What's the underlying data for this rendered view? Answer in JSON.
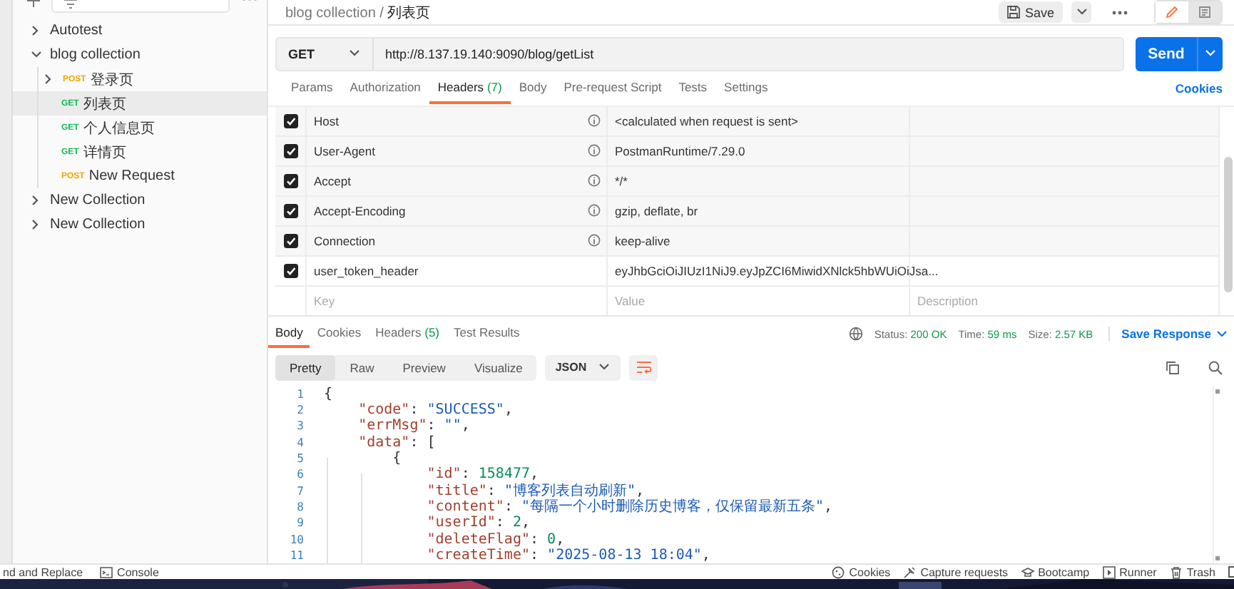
{
  "sidebar": {
    "tree": [
      {
        "kind": "collection",
        "label": "Autotest",
        "expanded": false,
        "selected": false
      },
      {
        "kind": "collection",
        "label": "blog collection",
        "expanded": true,
        "selected": false,
        "children": [
          {
            "kind": "folder",
            "method": "POST",
            "label": "登录页",
            "expanded": false,
            "selected": false
          },
          {
            "kind": "request",
            "method": "GET",
            "label": "列表页",
            "selected": true
          },
          {
            "kind": "request",
            "method": "GET",
            "label": "个人信息页",
            "selected": false
          },
          {
            "kind": "request",
            "method": "GET",
            "label": "详情页",
            "selected": false
          },
          {
            "kind": "request",
            "method": "POST",
            "label": "New Request",
            "selected": false
          }
        ]
      },
      {
        "kind": "collection",
        "label": "New Collection",
        "expanded": false,
        "selected": false
      },
      {
        "kind": "collection",
        "label": "New Collection",
        "expanded": false,
        "selected": false
      }
    ]
  },
  "breadcrumb": {
    "parent": "blog collection",
    "separator": "/",
    "current": "列表页"
  },
  "toolbar": {
    "save": "Save",
    "modes": [
      {
        "kind": "edit",
        "selected": true
      },
      {
        "kind": "docs",
        "selected": false
      }
    ]
  },
  "request": {
    "method": "GET",
    "url": "http://8.137.19.140:9090/blog/getList",
    "send": "Send"
  },
  "request_tabs": [
    {
      "label": "Params",
      "selected": false
    },
    {
      "label": "Authorization",
      "selected": false
    },
    {
      "label": "Headers",
      "count": "(7)",
      "selected": true
    },
    {
      "label": "Body",
      "selected": false
    },
    {
      "label": "Pre-request Script",
      "selected": false
    },
    {
      "label": "Tests",
      "selected": false
    },
    {
      "label": "Settings",
      "selected": false
    }
  ],
  "cookies_link": "Cookies",
  "headers": [
    {
      "checked": true,
      "key": "Host",
      "auto": true,
      "value": "<calculated when request is sent>"
    },
    {
      "checked": true,
      "key": "User-Agent",
      "auto": true,
      "value": "PostmanRuntime/7.29.0"
    },
    {
      "checked": true,
      "key": "Accept",
      "auto": true,
      "value": "*/*"
    },
    {
      "checked": true,
      "key": "Accept-Encoding",
      "auto": true,
      "value": "gzip, deflate, br"
    },
    {
      "checked": true,
      "key": "Connection",
      "auto": true,
      "value": "keep-alive"
    },
    {
      "checked": true,
      "key": "user_token_header",
      "auto": false,
      "value": "eyJhbGciOiJIUzI1NiJ9.eyJpZCI6MiwidXNlck5hbWUiOiJsa..."
    }
  ],
  "new_header": {
    "key": {
      "placeholder": "Key"
    },
    "value": {
      "placeholder": "Value"
    },
    "description": {
      "placeholder": "Description"
    }
  },
  "response": {
    "tabs": [
      {
        "label": "Body",
        "selected": true
      },
      {
        "label": "Cookies",
        "selected": false
      },
      {
        "label": "Headers",
        "count": "(5)",
        "selected": false
      },
      {
        "label": "Test Results",
        "selected": false
      }
    ],
    "status_label": "Status:",
    "status": "200 OK",
    "time_label": "Time:",
    "time": "59 ms",
    "size_label": "Size:",
    "size": "2.57 KB",
    "save_response": "Save Response",
    "views": [
      {
        "label": "Pretty",
        "selected": true
      },
      {
        "label": "Raw",
        "selected": false
      },
      {
        "label": "Preview",
        "selected": false
      },
      {
        "label": "Visualize",
        "selected": false
      }
    ],
    "format": "JSON",
    "code_lines": [
      {
        "number": "1",
        "tokens": [
          {
            "kind": "punct",
            "text": "{"
          }
        ]
      },
      {
        "number": "2",
        "tokens": [
          {
            "kind": "key",
            "text": "    \"code\""
          },
          {
            "kind": "punct",
            "text": ": "
          },
          {
            "kind": "string",
            "text": "\"SUCCESS\""
          },
          {
            "kind": "punct",
            "text": ","
          }
        ]
      },
      {
        "number": "3",
        "tokens": [
          {
            "kind": "key",
            "text": "    \"errMsg\""
          },
          {
            "kind": "punct",
            "text": ": "
          },
          {
            "kind": "string",
            "text": "\"\""
          },
          {
            "kind": "punct",
            "text": ","
          }
        ]
      },
      {
        "number": "4",
        "tokens": [
          {
            "kind": "key",
            "text": "    \"data\""
          },
          {
            "kind": "punct",
            "text": ": ["
          }
        ]
      },
      {
        "number": "5",
        "tokens": [
          {
            "kind": "punct",
            "text": "        {"
          }
        ]
      },
      {
        "number": "6",
        "tokens": [
          {
            "kind": "key",
            "text": "            \"id\""
          },
          {
            "kind": "punct",
            "text": ": "
          },
          {
            "kind": "number",
            "text": "158477"
          },
          {
            "kind": "punct",
            "text": ","
          }
        ]
      },
      {
        "number": "7",
        "tokens": [
          {
            "kind": "key",
            "text": "            \"title\""
          },
          {
            "kind": "punct",
            "text": ": "
          },
          {
            "kind": "string",
            "text": "\"博客列表自动刷新\""
          },
          {
            "kind": "punct",
            "text": ","
          }
        ]
      },
      {
        "number": "8",
        "tokens": [
          {
            "kind": "key",
            "text": "            \"content\""
          },
          {
            "kind": "punct",
            "text": ": "
          },
          {
            "kind": "string",
            "text": "\"每隔一个小时删除历史博客，仅保留最新五条\""
          },
          {
            "kind": "punct",
            "text": ","
          }
        ]
      },
      {
        "number": "9",
        "tokens": [
          {
            "kind": "key",
            "text": "            \"userId\""
          },
          {
            "kind": "punct",
            "text": ": "
          },
          {
            "kind": "number",
            "text": "2"
          },
          {
            "kind": "punct",
            "text": ","
          }
        ]
      },
      {
        "number": "10",
        "tokens": [
          {
            "kind": "key",
            "text": "            \"deleteFlag\""
          },
          {
            "kind": "punct",
            "text": ": "
          },
          {
            "kind": "number",
            "text": "0"
          },
          {
            "kind": "punct",
            "text": ","
          }
        ]
      },
      {
        "number": "11",
        "tokens": [
          {
            "kind": "key",
            "text": "            \"createTime\""
          },
          {
            "kind": "punct",
            "text": ": "
          },
          {
            "kind": "string",
            "text": "\"2025-08-13 18:04\""
          },
          {
            "kind": "punct",
            "text": ","
          }
        ]
      }
    ]
  },
  "status_bar": {
    "left": [
      {
        "kind": "find",
        "label": "nd and Replace"
      },
      {
        "kind": "console",
        "label": "Console"
      }
    ],
    "right": [
      {
        "kind": "cookies",
        "label": "Cookies"
      },
      {
        "kind": "capture",
        "label": "Capture requests"
      },
      {
        "kind": "bootcamp",
        "label": "Bootcamp"
      },
      {
        "kind": "runner",
        "label": "Runner"
      },
      {
        "kind": "trash",
        "label": "Trash"
      }
    ]
  }
}
